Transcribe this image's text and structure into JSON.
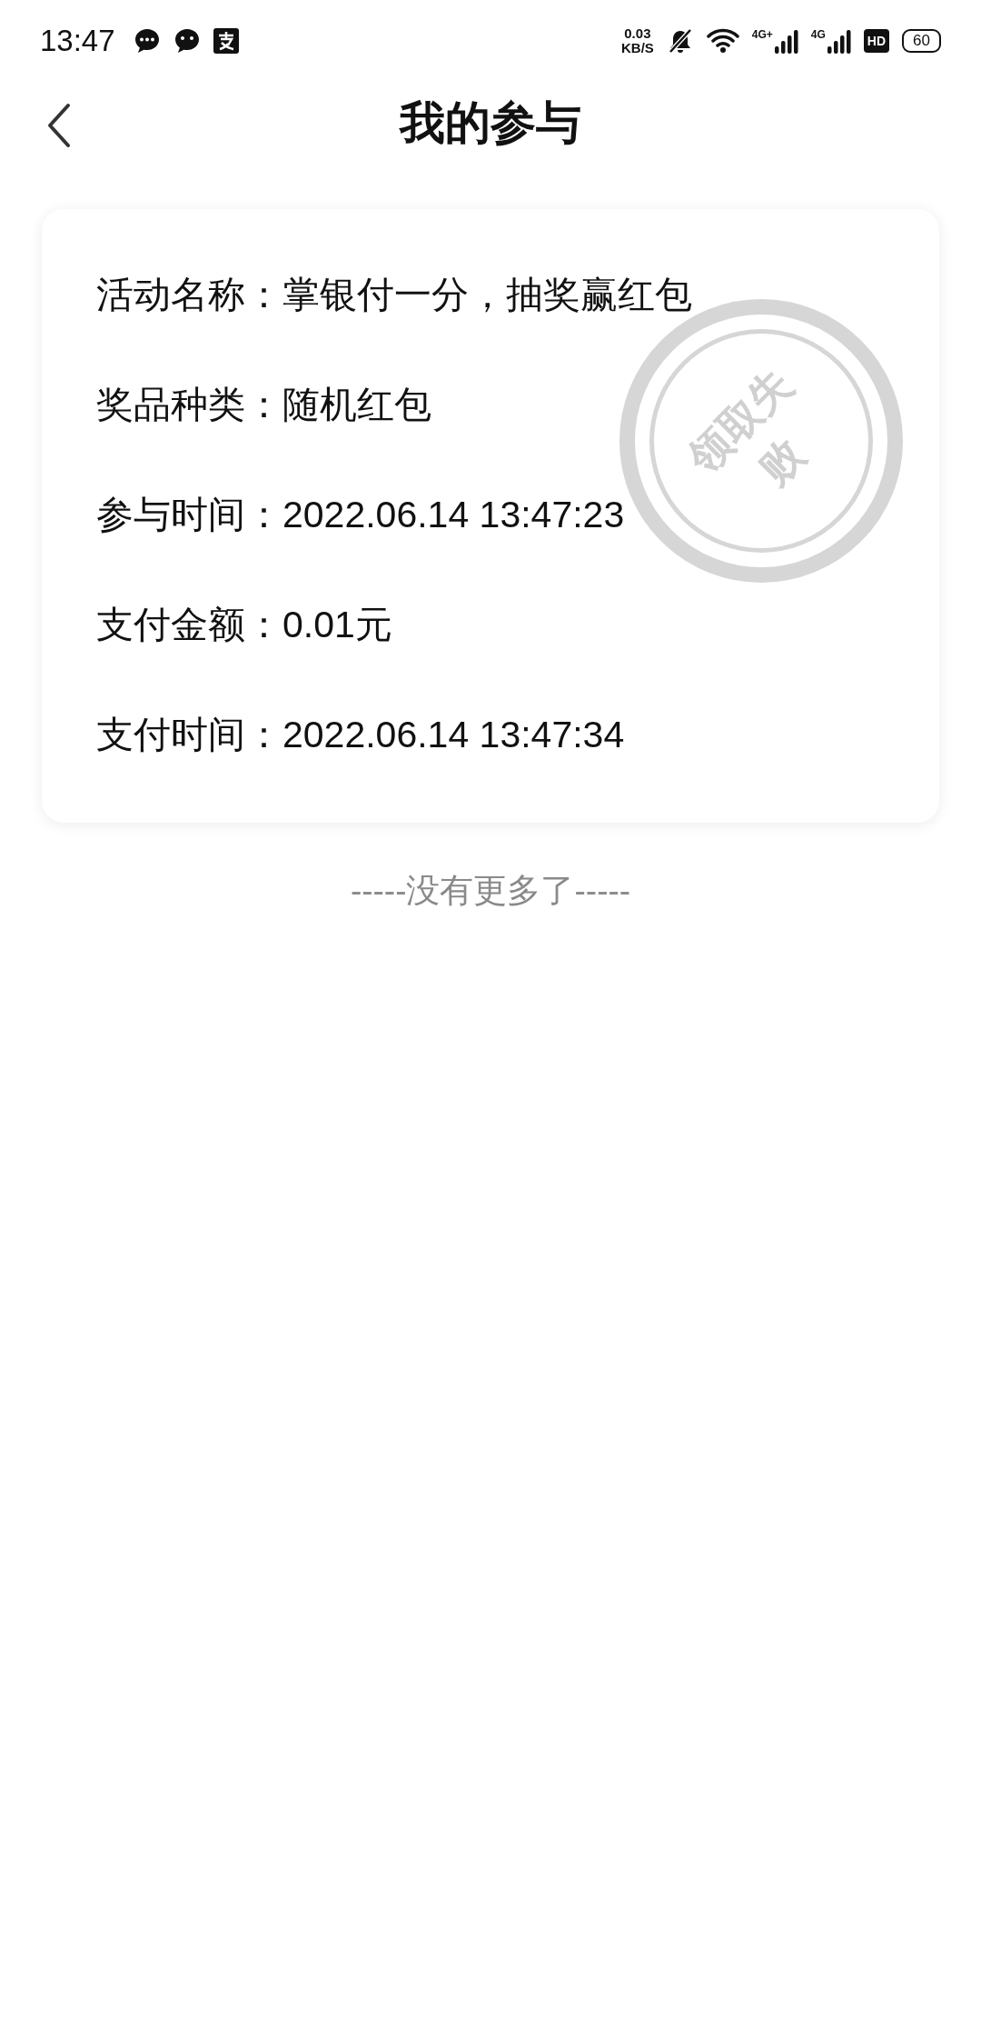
{
  "status_bar": {
    "time": "13:47",
    "net_speed": [
      "0.03",
      "KB/S"
    ],
    "signals": [
      {
        "label": "4G+"
      },
      {
        "label": "4G"
      }
    ],
    "hd_label": "HD",
    "battery": "60"
  },
  "header": {
    "title": "我的参与"
  },
  "record": {
    "fields": [
      {
        "label": "活动名称：",
        "value": "掌银付一分，抽奖赢红包"
      },
      {
        "label": "奖品种类：",
        "value": "随机红包"
      },
      {
        "label": "参与时间：",
        "value": "2022.06.14 13:47:23"
      },
      {
        "label": "支付金额：",
        "value": "0.01元"
      },
      {
        "label": "支付时间：",
        "value": "2022.06.14 13:47:34"
      }
    ],
    "stamp": "领取失败"
  },
  "footer": "-----没有更多了-----"
}
